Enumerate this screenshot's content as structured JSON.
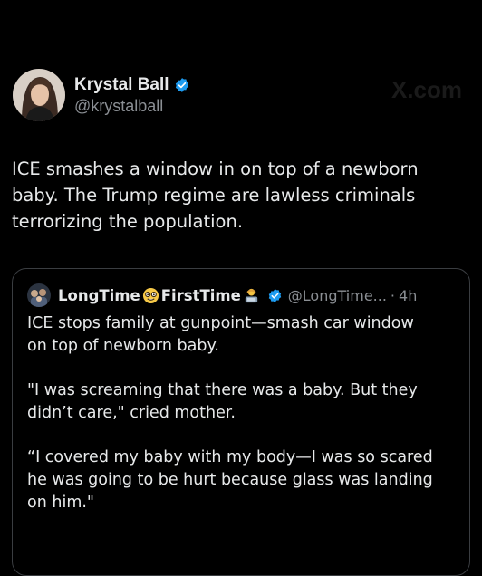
{
  "watermark": "X.com",
  "tweet": {
    "author": {
      "display_name": "Krystal Ball",
      "handle": "@krystalball",
      "verified_icon": "verified-badge-icon"
    },
    "text": "ICE smashes a window in on top of a newborn\nbaby. The Trump regime are lawless criminals\nterrorizing the population."
  },
  "quote": {
    "author": {
      "name_part_1": "LongTime",
      "name_part_2": "FirstTime",
      "emoji_1": "nerd-face-emoji",
      "emoji_2": "technologist-emoji",
      "verified_icon": "verified-badge-icon",
      "handle": "@LongTime...",
      "separator": "·",
      "time": "4h"
    },
    "paragraphs": [
      "ICE stops family at gunpoint—smash car window\non top of newborn baby.",
      "\"I was screaming that there was a baby.  But they\ndidn’t care,\" cried mother.",
      "“I covered my baby with my body—I was so scared\nhe was going to be hurt because glass was landing\non him.\""
    ]
  },
  "colors": {
    "background": "#000000",
    "text_primary": "#e7e9ea",
    "text_secondary": "#8b8f94",
    "verified_blue": "#1d9bf0",
    "card_border": "#3a3d41"
  }
}
